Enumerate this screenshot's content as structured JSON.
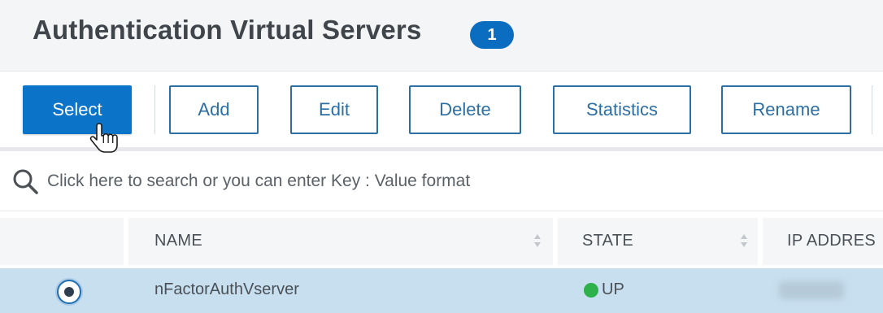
{
  "header": {
    "title": "Authentication Virtual Servers",
    "count": "1"
  },
  "toolbar": {
    "select_label": "Select",
    "add_label": "Add",
    "edit_label": "Edit",
    "delete_label": "Delete",
    "statistics_label": "Statistics",
    "rename_label": "Rename"
  },
  "search": {
    "placeholder": "Click here to search or you can enter Key : Value format"
  },
  "table": {
    "columns": [
      "NAME",
      "STATE",
      "IP ADDRES"
    ],
    "rows": [
      {
        "name": "nFactorAuthVserver",
        "state": "UP",
        "selected": true
      }
    ]
  },
  "colors": {
    "accent": "#0b74c8",
    "badge": "#0b6dbf",
    "selected_row": "#c7dfef",
    "state_up": "#2eb14b"
  },
  "icons": [
    "search-icon",
    "sort-icon",
    "hand-pointer-icon"
  ]
}
